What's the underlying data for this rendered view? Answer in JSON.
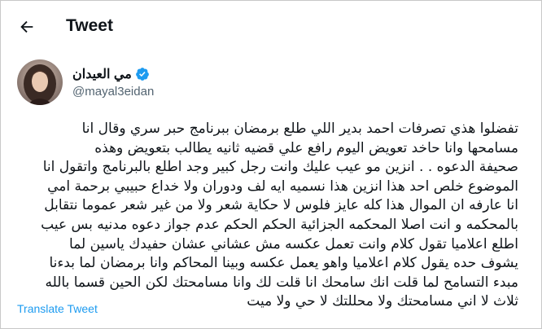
{
  "header": {
    "title": "Tweet",
    "back_icon": "arrow-left-icon"
  },
  "author": {
    "display_name": "مي العيدان",
    "handle": "@mayal3eidan",
    "verified_icon": "verified-badge-icon"
  },
  "tweet": {
    "lines": [
      "تفضلوا هذي تصرفات احمد بدير اللي طلع برمضان ببرنامج حبر سري وقال انا",
      "مسامحها وانا حاخد تعويض اليوم رافع علي قضيه ثانيه يطالب بتعويض وهذه",
      "صحيفة الدعوه . . انزين مو عيب عليك وانت رجل كبير وجد اطلع بالبرنامج واتقول انا",
      "الموضوع خلص احد هذا انزين هذا نسميه ايه لف ودوران ولا خداع حبيبي برحمة امي",
      "انا عارفه ان الموال هذا كله عايز فلوس لا حكاية شعر ولا من غير شعر عموما نتقابل",
      "بالمحكمه و انت اصلا المحكمه الجزائية الحكم الحكم عدم جواز دعوه مدنيه بس عيب",
      "اطلع اعلاميا تقول كلام وانت تعمل عكسه مش عشاني عشان حفيدك ياسين لما",
      "يشوف حده يقول كلام اعلاميا واهو يعمل عكسه وبينا المحاكم وانا برمضان لما بدءنا",
      "مبدء التسامح لما قلت انك سامحك انا قلت لك وانا مسامحتك لكن الحين قسما بالله",
      "ثلاث لا اني مسامحتك ولا محللتك لا حي ولا ميت"
    ],
    "translate_label": "Translate Tweet"
  },
  "colors": {
    "text": "#0f1419",
    "secondary": "#536471",
    "link": "#1d9bf0",
    "verified": "#1d9bf0"
  }
}
